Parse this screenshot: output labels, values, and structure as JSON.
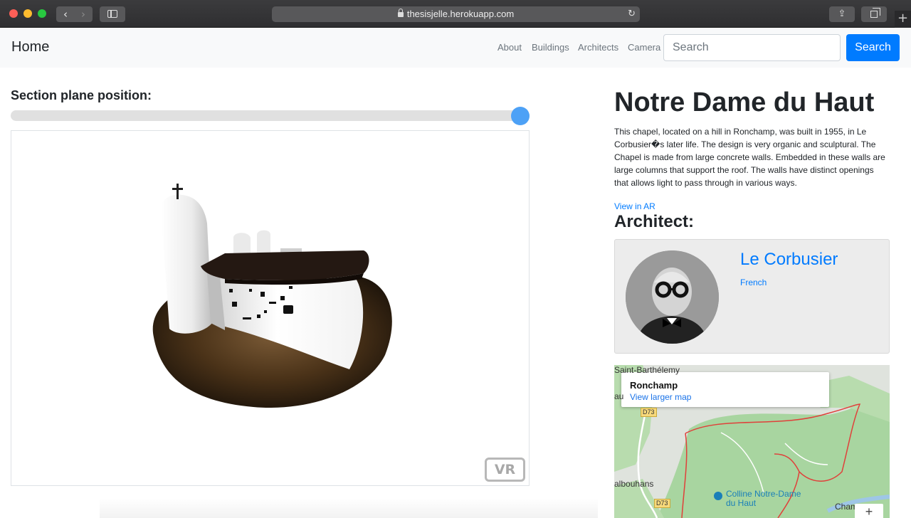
{
  "browser": {
    "url": "thesisjelle.herokuapp.com",
    "back_icon": "‹",
    "forward_icon": "›",
    "reload_icon": "↻",
    "share_icon": "⇪",
    "new_tab_icon": "+"
  },
  "navbar": {
    "brand": "Home",
    "links": [
      "About",
      "Buildings",
      "Architects",
      "Camera"
    ],
    "search_placeholder": "Search",
    "search_button": "Search"
  },
  "viewer": {
    "section_label": "Section plane position:",
    "slider_value": 1.0,
    "vr_label": "VR"
  },
  "building": {
    "title": "Notre Dame du Haut",
    "description": "This chapel, located on a hill in Ronchamp, was built in 1955, in Le Corbusier�s later life. The design is very organic and sculptural. The Chapel is made from large concrete walls. Embedded in these walls are large columns that support the roof. The walls have distinct openings that allows light to pass through in various ways.",
    "ar_link": "View in AR"
  },
  "architect": {
    "heading": "Architect:",
    "name": "Le Corbusier",
    "nationality": "French"
  },
  "map": {
    "place": "Ronchamp",
    "larger_map": "View larger map",
    "labels": {
      "top": "Saint-Barthélemy",
      "side": "au",
      "left": "albouhans",
      "bottom_right": "Champ"
    },
    "roads": [
      "D73",
      "D73"
    ],
    "poi": "Colline Notre-Dame du Haut",
    "zoom_in": "+"
  },
  "colors": {
    "primary": "#007bff",
    "slider_thumb": "#4da1f6",
    "navbar_bg": "#f8f9fa",
    "map_boundary": "#e0403a",
    "map_forest": "#a8d5a0"
  }
}
